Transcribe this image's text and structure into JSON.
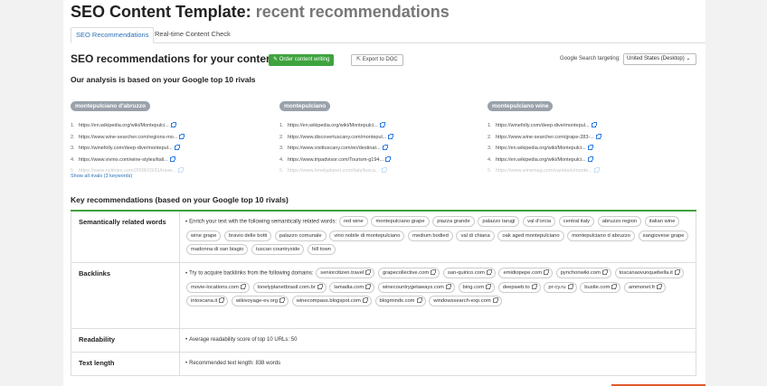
{
  "header": {
    "title_main": "SEO Content Template: ",
    "title_sub": "recent recommendations"
  },
  "tabs": [
    {
      "label": "SEO Recommendations",
      "active": true
    },
    {
      "label": "Real-time Content Check",
      "active": false
    }
  ],
  "section": {
    "title": "SEO recommendations for your content",
    "order_button": "Order content writing",
    "export_button": "Export to DOC",
    "targeting_label": "Google Search targeting:",
    "targeting_value": "United States (Desktop)",
    "analysis_heading": "Our analysis is based on your Google top 10 rivals",
    "show_all_link": "Show all rivals (3 keywords)"
  },
  "rivals": [
    {
      "keyword": "montepulciano d'abruzzo",
      "urls": [
        "https://en.wikipedia.org/wiki/Montepulci...",
        "https://www.wine-searcher.com/regions-mo...",
        "https://winefolly.com/deep-dive/montepul...",
        "https://www.vivino.com/wine-styles/itali...",
        "https://www.nytimes.com/2008/10/31/trave..."
      ]
    },
    {
      "keyword": "montepulciano",
      "urls": [
        "https://en.wikipedia.org/wiki/Montepulci...",
        "https://www.discovertuscany.com/montepul...",
        "https://www.visittuscany.com/en/destinat...",
        "https://www.tripadvisor.com/Tourism-g194...",
        "https://www.lonelyplanet.com/italy/tusca..."
      ]
    },
    {
      "keyword": "montepulciano wine",
      "urls": [
        "https://winefolly.com/deep-dive/montepul...",
        "https://www.wine-searcher.com/grape-283-...",
        "https://en.wikipedia.org/wiki/Montepulci...",
        "https://en.wikipedia.org/wiki/Montepulci...",
        "https://www.winemag.com/varietals/monte..."
      ]
    }
  ],
  "key_recs": {
    "heading": "Key recommendations (based on your Google top 10 rivals)",
    "semantic": {
      "label": "Semantically related words",
      "intro": "Enrich your text with the following semantically related words:",
      "words": [
        "red wine",
        "montepulciano grape",
        "piazza grande",
        "palazzo tarugi",
        "val d'orcia",
        "central italy",
        "abruzzo region",
        "italian wine",
        "wine grape",
        "bravio delle botti",
        "palazzo comunale",
        "vino nobile di montepulciano",
        "medium bodied",
        "val di chiana",
        "oak aged montepulciano",
        "montepulciano d abruzzo",
        "sangiovese grape",
        "madonna di san biagio",
        "tuscan countryside",
        "hill town"
      ]
    },
    "backlinks": {
      "label": "Backlinks",
      "intro": "Try to acquire backlinks from the following domains:",
      "domains": [
        "seniorcitizen.travel",
        "grapecollective.com",
        "san-quirico.com",
        "emidiopepe.com",
        "pynchonwiki.com",
        "toscanaovunquebella.it",
        "movie-locations.com",
        "lonelyplanetbrasil.com.br",
        "lamadia.com",
        "winecountrygetaways.com",
        "bing.com",
        "deepweb.to",
        "pr-cy.ru",
        "bustle.com",
        "ammonet.fr",
        "intoscana.it",
        "wikivoyage-ev.org",
        "winecompass.blogspot.com",
        "blogminds.com",
        "windowssearch-exp.com"
      ]
    },
    "readability": {
      "label": "Readability",
      "text": "Average readability score of top 10 URLs:  50"
    },
    "text_length": {
      "label": "Text length",
      "text": "Recommended text length:  838 words"
    }
  }
}
